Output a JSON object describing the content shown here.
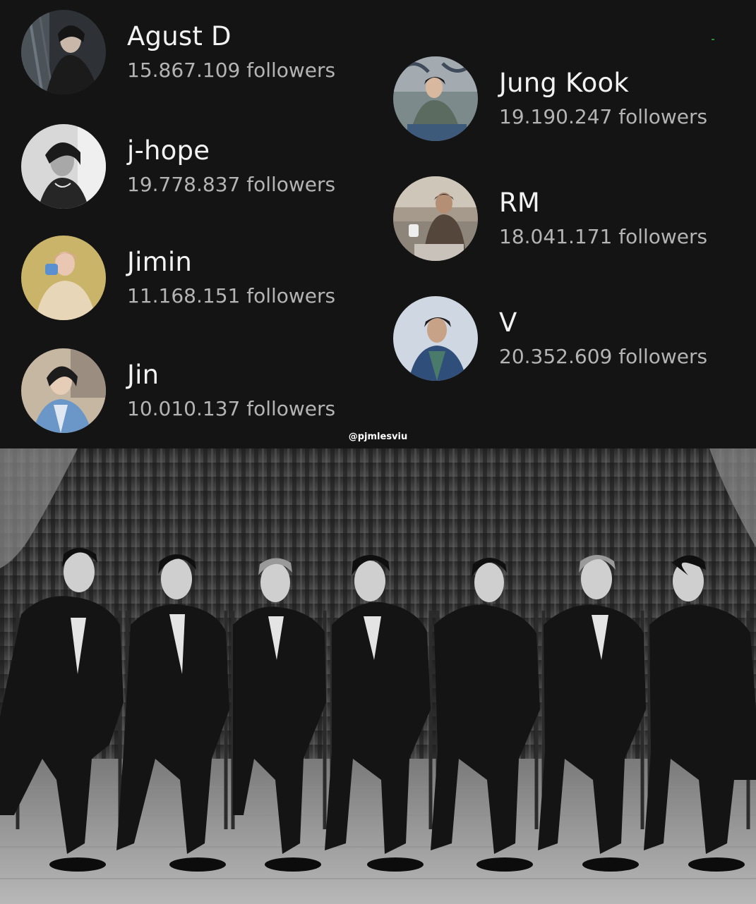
{
  "artists_left": [
    {
      "name": "Agust D",
      "followers": "15.867.109 followers",
      "avatar_icon": "artist-avatar",
      "bg": "#2e3236"
    },
    {
      "name": "j-hope",
      "followers": "19.778.837 followers",
      "avatar_icon": "artist-avatar",
      "bg": "#d8d8d8"
    },
    {
      "name": "Jimin",
      "followers": "11.168.151 followers",
      "avatar_icon": "artist-avatar",
      "bg": "#c9b46a"
    },
    {
      "name": "Jin",
      "followers": "10.010.137 followers",
      "avatar_icon": "artist-avatar",
      "bg": "#c6b7a2"
    }
  ],
  "artists_right": [
    {
      "name": "Jung Kook",
      "followers": "19.190.247 followers",
      "avatar_icon": "artist-avatar",
      "bg": "#7c8a8c"
    },
    {
      "name": "RM",
      "followers": "18.041.171 followers",
      "avatar_icon": "artist-avatar",
      "bg": "#a59a8c"
    },
    {
      "name": "V",
      "followers": "20.352.609 followers",
      "avatar_icon": "artist-avatar",
      "bg": "#cfd7e2"
    }
  ],
  "watermark": "@pjmlesviu",
  "colors": {
    "background": "#141414",
    "name_text": "#f2f2f2",
    "followers_text": "#b4b4b4"
  }
}
